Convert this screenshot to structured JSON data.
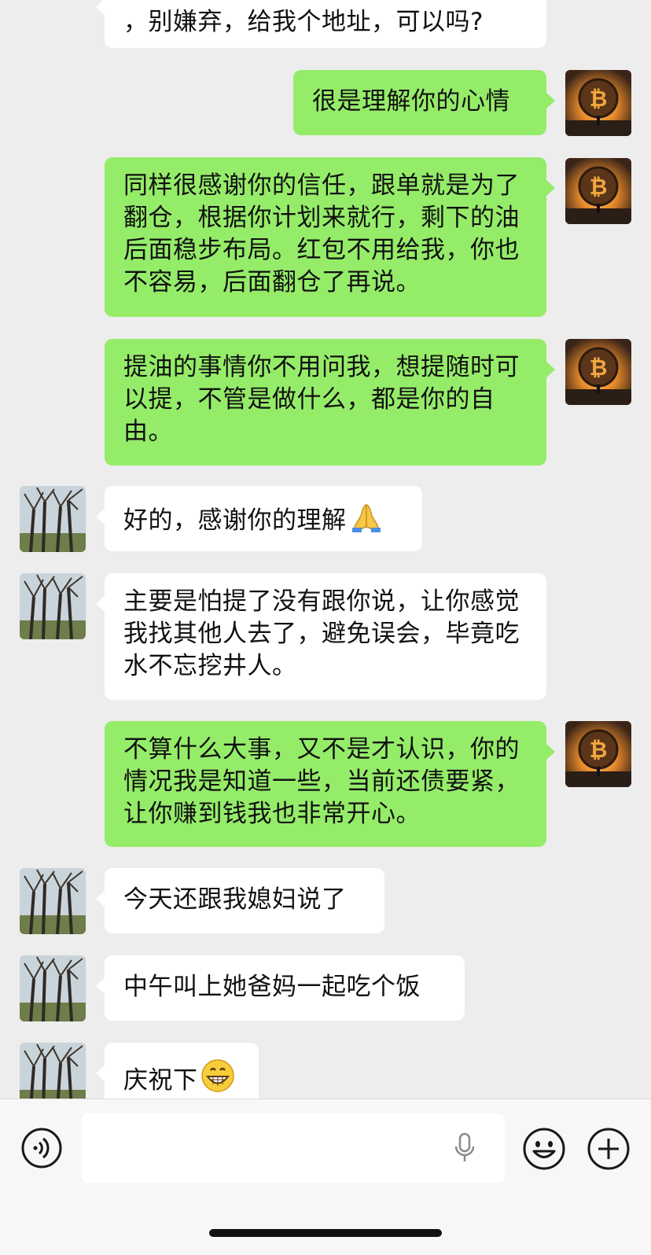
{
  "messages": [
    {
      "side": "in",
      "text": "，别嫌弃，给我个地址，可以吗?",
      "emoji": ""
    },
    {
      "side": "out",
      "text": "很是理解你的心情",
      "emoji": ""
    },
    {
      "side": "out",
      "text": "同样很感谢你的信任，跟单就是为了翻仓，根据你计划来就行，剩下的油后面稳步布局。红包不用给我，你也不容易，后面翻仓了再说。",
      "emoji": ""
    },
    {
      "side": "out",
      "text": "提油的事情你不用问我，想提随时可以提，不管是做什么，都是你的自由。",
      "emoji": ""
    },
    {
      "side": "in",
      "text": "好的，感谢你的理解",
      "emoji": "folded-hands"
    },
    {
      "side": "in",
      "text": "主要是怕提了没有跟你说，让你感觉我找其他人去了，避免误会，毕竟吃水不忘挖井人。",
      "emoji": ""
    },
    {
      "side": "out",
      "text": "不算什么大事，又不是才认识，你的情况我是知道一些，当前还债要紧，让你赚到钱我也非常开心。",
      "emoji": ""
    },
    {
      "side": "in",
      "text": "今天还跟我媳妇说了",
      "emoji": ""
    },
    {
      "side": "in",
      "text": "中午叫上她爸妈一起吃个饭",
      "emoji": ""
    },
    {
      "side": "in",
      "text": "庆祝下",
      "emoji": "grinning-face"
    }
  ],
  "avatars": {
    "contact": "tree-photo-avatar",
    "self": "bitcoin-sunset-avatar"
  },
  "input_bar": {
    "voice_icon": "voice-icon",
    "mic_icon": "microphone-icon",
    "emoji_icon": "emoji-face-icon",
    "plus_icon": "plus-icon",
    "input_value": ""
  },
  "colors": {
    "background": "#ededed",
    "incoming_bubble": "#ffffff",
    "outgoing_bubble": "#95ec69"
  }
}
